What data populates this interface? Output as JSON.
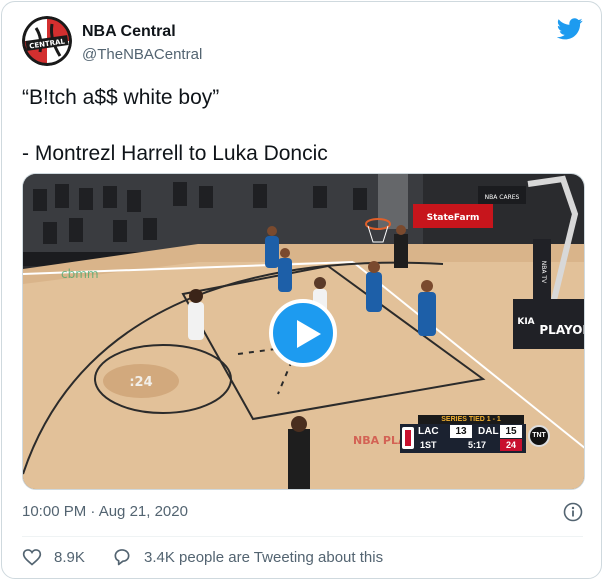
{
  "author": {
    "name": "NBA Central",
    "handle": "@TheNBACentral",
    "avatar_text": "CENTRAL",
    "avatar_icon": "nba-central-logo"
  },
  "platform_icon": "twitter-bird-icon",
  "tweet": {
    "text": "“B!tch a$$ white boy”\n\n- Montrezl Harrell to Luka Doncic"
  },
  "video": {
    "arena_signs": [
      "StateFarm",
      "NBA CARES",
      "PLAYOF",
      "NBA TV",
      "KIA"
    ],
    "floor_marking": ":24",
    "scorebug": {
      "series": "SERIES TIED 1 - 1",
      "team1": "LAC",
      "score1": "13",
      "team2": "DAL",
      "score2": "15",
      "quarter": "1ST",
      "clock": "5:17",
      "shot_clock": "24",
      "network": "TNT"
    }
  },
  "timestamp": "10:00 PM · Aug 21, 2020",
  "actions": {
    "likes": "8.9K",
    "replies_text": "3.4K people are Tweeting about this"
  },
  "colors": {
    "twitter_blue": "#1d9bf0",
    "secondary_text": "#536471",
    "heading_text": "#0f1419"
  }
}
